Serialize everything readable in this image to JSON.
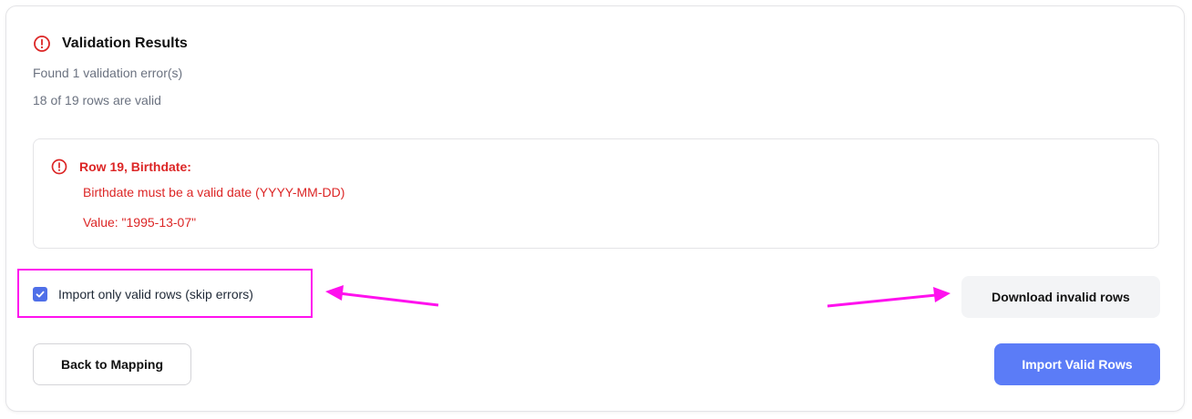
{
  "header": {
    "title": "Validation Results",
    "icon": "alert-circle-icon"
  },
  "summary": {
    "errors_text": "Found 1 validation error(s)",
    "valid_rows_text": "18 of 19 rows are valid"
  },
  "error_item": {
    "title": "Row 19, Birthdate:",
    "message": "Birthdate must be a valid date (YYYY-MM-DD)",
    "value_text": "Value: \"1995-13-07\"",
    "icon": "alert-circle-icon"
  },
  "options": {
    "skip_errors_label": "Import only valid rows (skip errors)",
    "skip_errors_checked": true
  },
  "buttons": {
    "download_invalid": "Download invalid rows",
    "back": "Back to Mapping",
    "import_valid": "Import Valid Rows"
  },
  "colors": {
    "error": "#dc2626",
    "primary": "#5b7cf7",
    "checkbox": "#4f6fe8",
    "annotation": "#ff11ee"
  }
}
